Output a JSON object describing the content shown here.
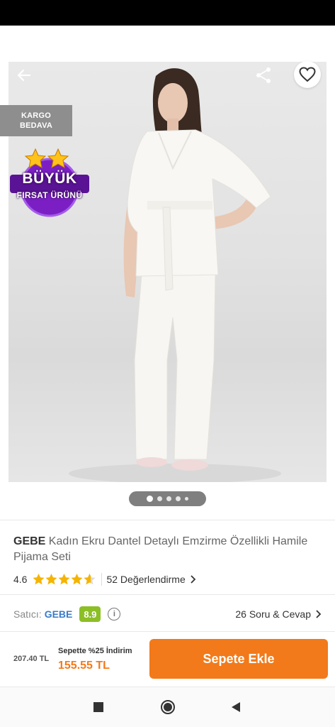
{
  "product": {
    "badges": {
      "shipping_line1": "KARGO",
      "shipping_line2": "BEDAVA",
      "deal_line1": "BÜYÜK",
      "deal_line2": "FIRSAT ÜRÜNÜ"
    },
    "image_carousel": {
      "total": 5,
      "active_index": 0
    },
    "brand": "GEBE",
    "name": "Kadın Ekru Dantel Detaylı Emzirme Özellikli Hamile Pijama Seti",
    "rating": {
      "score": "4.6",
      "stars_value": 4.6,
      "stars_max": 5,
      "reviews_label": "52 Değerlendirme"
    },
    "seller": {
      "label": "Satıcı:",
      "name": "GEBE",
      "score": "8.9",
      "score_color": "#8cbf26"
    },
    "qa_label": "26 Soru & Cevap"
  },
  "purchase": {
    "old_price": "207.40 TL",
    "promo_label": "Sepette %25 İndirim",
    "new_price": "155.55 TL",
    "add_to_cart_label": "Sepete Ekle"
  },
  "colors": {
    "accent": "#f27a1a",
    "seller_link": "#3a7bc8",
    "star": "#f5b400",
    "deal_badge": "#7b1fc4"
  },
  "icons": {
    "back": "arrow-left-icon",
    "share": "share-icon",
    "favorite": "heart-outline-icon",
    "info": "info-icon",
    "chevron": "chevron-right-icon",
    "nav_recent": "square-icon",
    "nav_home": "circle-icon",
    "nav_back": "triangle-back-icon"
  }
}
